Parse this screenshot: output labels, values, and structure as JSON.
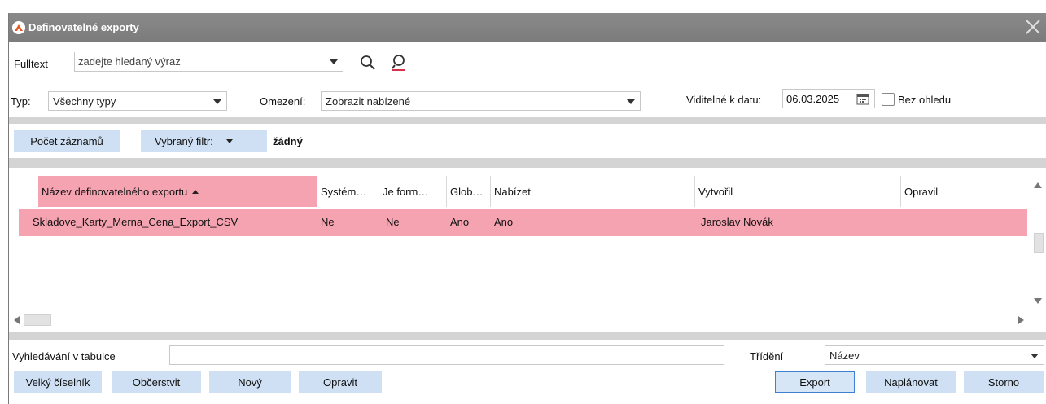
{
  "window": {
    "title": "Definovatelné exporty"
  },
  "fulltext": {
    "label": "Fulltext",
    "placeholder": "zadejte hledaný výraz"
  },
  "filters": {
    "typ_label": "Typ:",
    "typ_value": "Všechny typy",
    "omezeni_label": "Omezení:",
    "omezeni_value": "Zobrazit nabízené",
    "viditelne_label": "Viditelné k datu:",
    "date_value": "06.03.2025",
    "bez_ohledu_label": "Bez ohledu"
  },
  "toolbar": {
    "pocet_zaznamu": "Počet záznamů",
    "vybrany_filtr": "Vybraný filtr:",
    "filter_value": "žádný"
  },
  "table": {
    "columns": [
      "Název definovatelného exportu",
      "Systém…",
      "Je form…",
      "Glob…",
      "Nabízet",
      "Vytvořil",
      "Opravil"
    ],
    "rows": [
      [
        "Skladove_Karty_Merna_Cena_Export_CSV",
        "Ne",
        "Ne",
        "Ano",
        "Ano",
        "Jaroslav Novák",
        ""
      ]
    ]
  },
  "bottom": {
    "search_label": "Vyhledávání v tabulce",
    "sort_label": "Třídění",
    "sort_value": "Název"
  },
  "buttons": {
    "velky_ciselnik": "Velký číselník",
    "obcerstvit": "Občerstvit",
    "novy": "Nový",
    "opravit": "Opravit",
    "export": "Export",
    "naplanovat": "Naplánovat",
    "storno": "Storno"
  },
  "colors": {
    "titlebar": "#808080",
    "selection": "#f5a3b1",
    "button": "#cfe0f4",
    "focus": "#3f7fd0"
  }
}
